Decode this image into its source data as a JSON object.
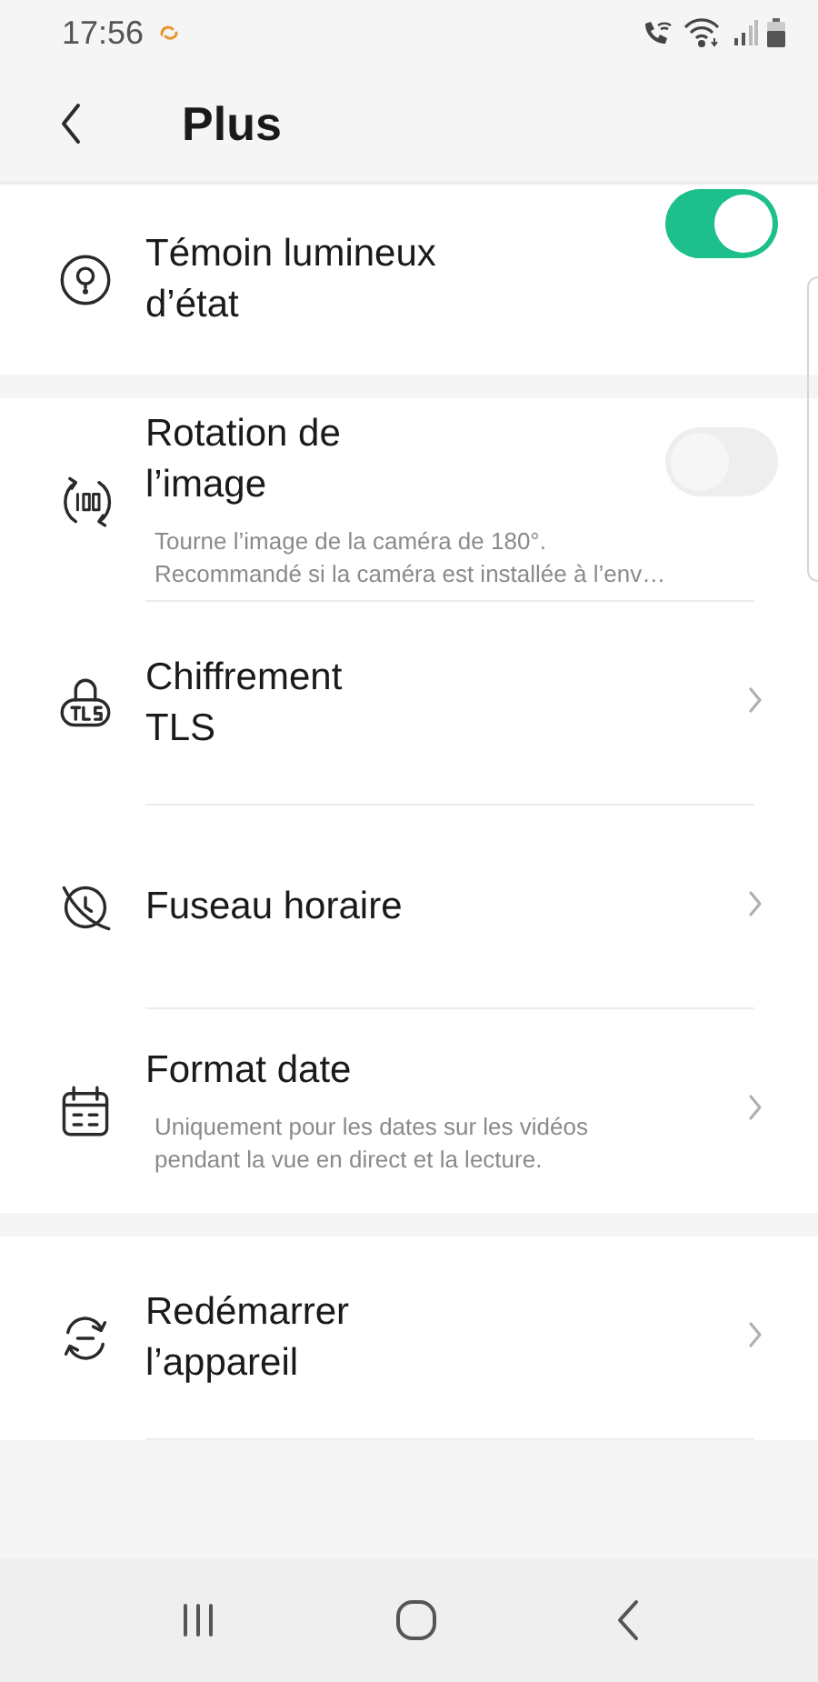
{
  "status_bar": {
    "time": "17:56"
  },
  "header": {
    "title": "Plus"
  },
  "sections": [
    {
      "rows": [
        {
          "kind": "toggle",
          "title": "Témoin lumineux\nd’état",
          "on": true
        }
      ]
    },
    {
      "rows": [
        {
          "kind": "toggle",
          "title": "Rotation de\nl’image",
          "on": false,
          "description": "Tourne l’image de la caméra de 180°.\nRecommandé si la caméra est installée à l’env…"
        },
        {
          "kind": "link",
          "title": "Chiffrement\nTLS"
        },
        {
          "kind": "link",
          "title": "Fuseau horaire"
        },
        {
          "kind": "link",
          "title": "Format date",
          "description": "Uniquement pour les dates sur les vidéos\npendant la vue en direct et la lecture."
        }
      ]
    },
    {
      "rows": [
        {
          "kind": "link",
          "title": "Redémarrer\nl’appareil"
        }
      ]
    }
  ]
}
